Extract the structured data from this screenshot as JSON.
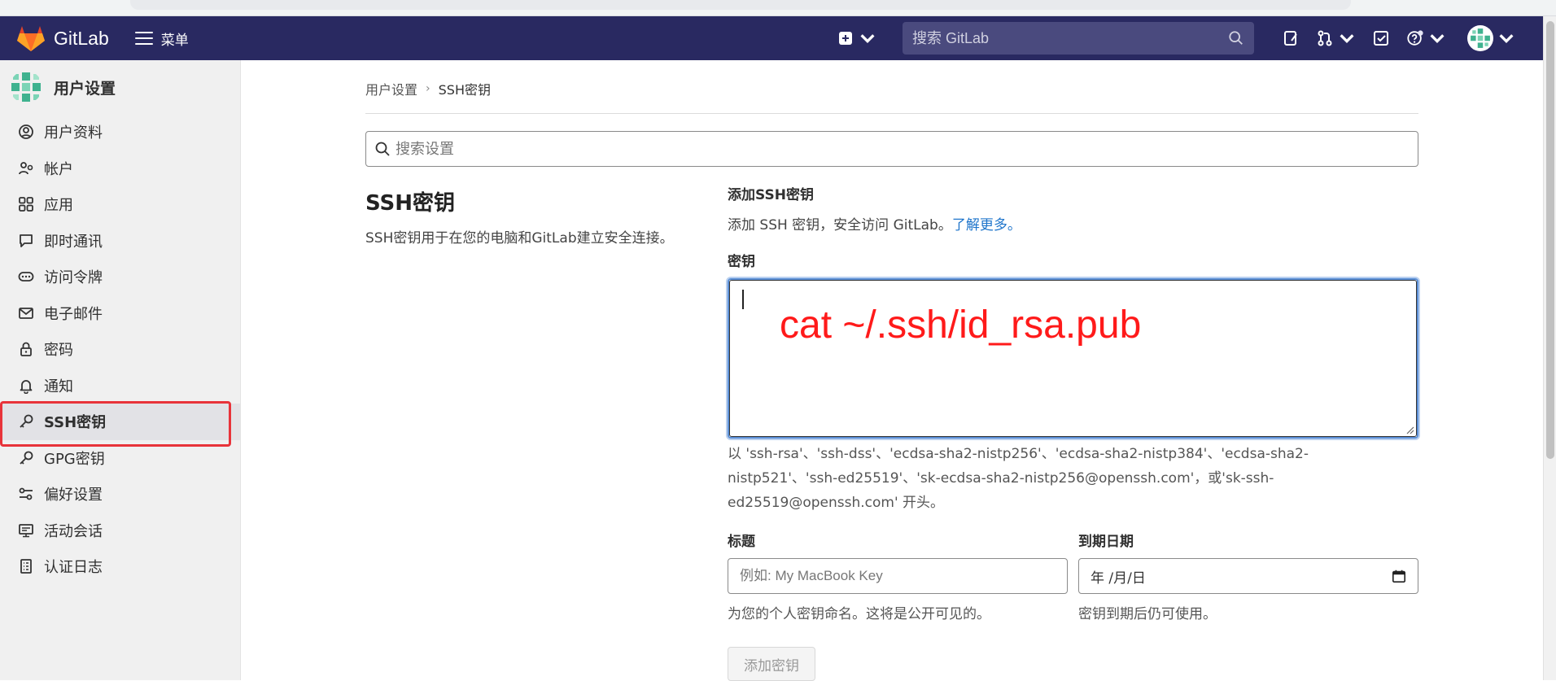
{
  "app": {
    "brand": "GitLab",
    "menu_label": "菜单"
  },
  "header": {
    "search_placeholder": "搜索 GitLab"
  },
  "sidebar": {
    "title": "用户设置",
    "items": [
      {
        "label": "用户资料",
        "icon": "user-icon"
      },
      {
        "label": "帐户",
        "icon": "account-icon"
      },
      {
        "label": "应用",
        "icon": "applications-icon"
      },
      {
        "label": "即时通讯",
        "icon": "chat-icon"
      },
      {
        "label": "访问令牌",
        "icon": "token-icon"
      },
      {
        "label": "电子邮件",
        "icon": "mail-icon"
      },
      {
        "label": "密码",
        "icon": "lock-icon"
      },
      {
        "label": "通知",
        "icon": "bell-icon"
      },
      {
        "label": "SSH密钥",
        "icon": "key-icon",
        "active": true
      },
      {
        "label": "GPG密钥",
        "icon": "key-icon"
      },
      {
        "label": "偏好设置",
        "icon": "preferences-icon"
      },
      {
        "label": "活动会话",
        "icon": "monitor-icon"
      },
      {
        "label": "认证日志",
        "icon": "log-icon"
      }
    ]
  },
  "breadcrumb": {
    "parent": "用户设置",
    "current": "SSH密钥"
  },
  "settings_search": {
    "placeholder": "搜索设置"
  },
  "section": {
    "title": "SSH密钥",
    "description": "SSH密钥用于在您的电脑和GitLab建立安全连接。"
  },
  "form": {
    "heading": "添加SSH密钥",
    "intro": "添加 SSH 密钥，安全访问 GitLab。",
    "learn_more": "了解更多。",
    "key_label": "密钥",
    "key_value": "",
    "overlay_command": "cat ~/.ssh/id_rsa.pub",
    "key_hint": "以 'ssh-rsa'、'ssh-dss'、'ecdsa-sha2-nistp256'、'ecdsa-sha2-nistp384'、'ecdsa-sha2-nistp521'、'ssh-ed25519'、'sk-ecdsa-sha2-nistp256@openssh.com'，或'sk-ssh-ed25519@openssh.com' 开头。",
    "title_label": "标题",
    "title_placeholder": "例如: My MacBook Key",
    "title_hint": "为您的个人密钥命名。这将是公开可见的。",
    "expiry_label": "到期日期",
    "expiry_value": "年 /月/日",
    "expiry_hint": "密钥到期后仍可使用。",
    "submit_label": "添加密钥"
  },
  "colors": {
    "topbar": "#292961",
    "link": "#1f75cb",
    "highlight": "#e8333a",
    "overlay_text": "#ff1a1a"
  }
}
